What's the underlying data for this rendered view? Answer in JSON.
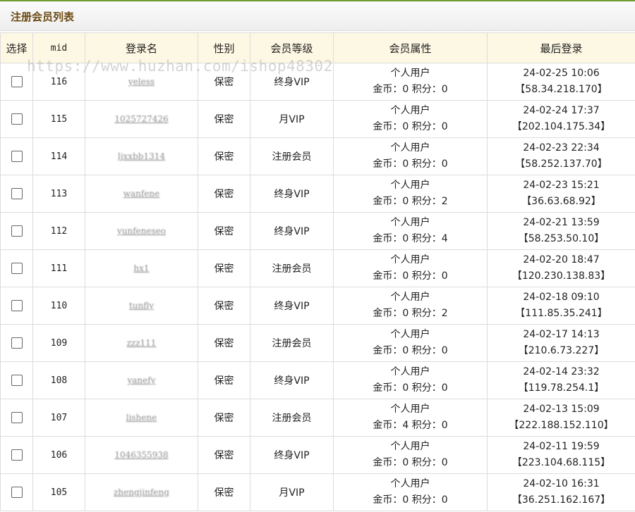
{
  "panel": {
    "title": "注册会员列表"
  },
  "watermark": "https://www.huzhan.com/ishop48302",
  "columns": [
    "选择",
    "mid",
    "登录名",
    "性别",
    "会员等级",
    "会员属性",
    "最后登录"
  ],
  "rows": [
    {
      "mid": "116",
      "login": "yeless",
      "gender": "保密",
      "level": "终身VIP",
      "type": "个人用户",
      "coins": "金币：0 积分：0",
      "last_time": "24-02-25 10:06",
      "last_ip": "【58.34.218.170】"
    },
    {
      "mid": "115",
      "login": "1025727426",
      "gender": "保密",
      "level": "月VIP",
      "type": "个人用户",
      "coins": "金币：0 积分：0",
      "last_time": "24-02-24 17:37",
      "last_ip": "【202.104.175.34】"
    },
    {
      "mid": "114",
      "login": "ljxxbb1314",
      "gender": "保密",
      "level": "注册会员",
      "type": "个人用户",
      "coins": "金币：0 积分：0",
      "last_time": "24-02-23 22:34",
      "last_ip": "【58.252.137.70】"
    },
    {
      "mid": "113",
      "login": "wanfene",
      "gender": "保密",
      "level": "终身VIP",
      "type": "个人用户",
      "coins": "金币：0 积分：2",
      "last_time": "24-02-23 15:21",
      "last_ip": "【36.63.68.92】"
    },
    {
      "mid": "112",
      "login": "yunfeneseo",
      "gender": "保密",
      "level": "终身VIP",
      "type": "个人用户",
      "coins": "金币：0 积分：4",
      "last_time": "24-02-21 13:59",
      "last_ip": "【58.253.50.10】"
    },
    {
      "mid": "111",
      "login": "hx1",
      "gender": "保密",
      "level": "注册会员",
      "type": "个人用户",
      "coins": "金币：0 积分：0",
      "last_time": "24-02-20 18:47",
      "last_ip": "【120.230.138.83】"
    },
    {
      "mid": "110",
      "login": "tunfly",
      "gender": "保密",
      "level": "终身VIP",
      "type": "个人用户",
      "coins": "金币：0 积分：2",
      "last_time": "24-02-18 09:10",
      "last_ip": "【111.85.35.241】"
    },
    {
      "mid": "109",
      "login": "zzz111",
      "gender": "保密",
      "level": "注册会员",
      "type": "个人用户",
      "coins": "金币：0 积分：0",
      "last_time": "24-02-17 14:13",
      "last_ip": "【210.6.73.227】"
    },
    {
      "mid": "108",
      "login": "yanefy",
      "gender": "保密",
      "level": "终身VIP",
      "type": "个人用户",
      "coins": "金币：0 积分：0",
      "last_time": "24-02-14 23:32",
      "last_ip": "【119.78.254.1】"
    },
    {
      "mid": "107",
      "login": "lishene",
      "gender": "保密",
      "level": "注册会员",
      "type": "个人用户",
      "coins": "金币：4 积分：0",
      "last_time": "24-02-13 15:09",
      "last_ip": "【222.188.152.110】"
    },
    {
      "mid": "106",
      "login": "1046355938",
      "gender": "保密",
      "level": "终身VIP",
      "type": "个人用户",
      "coins": "金币：0 积分：0",
      "last_time": "24-02-11 19:59",
      "last_ip": "【223.104.68.115】"
    },
    {
      "mid": "105",
      "login": "zhengjinfeng",
      "gender": "保密",
      "level": "月VIP",
      "type": "个人用户",
      "coins": "金币：0 积分：0",
      "last_time": "24-02-10 16:31",
      "last_ip": "【36.251.162.167】"
    }
  ]
}
